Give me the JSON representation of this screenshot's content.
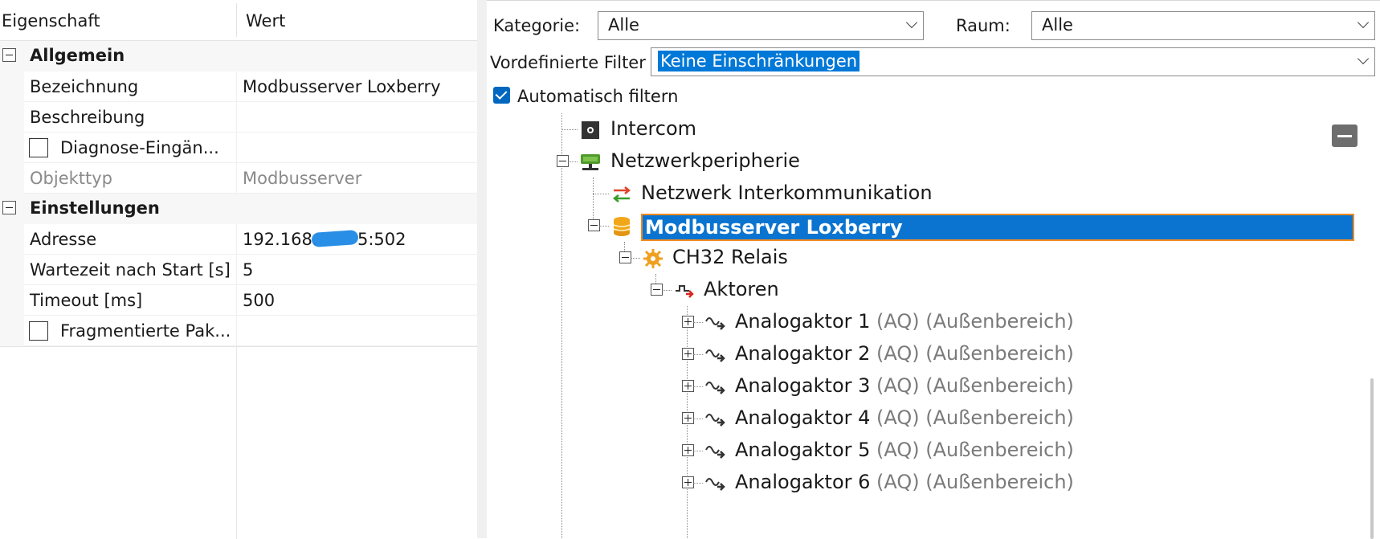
{
  "property_grid": {
    "headers": {
      "name": "Eigenschaft",
      "value": "Wert"
    },
    "categories": {
      "general": "Allgemein",
      "settings": "Einstellungen"
    },
    "rows": {
      "bezeichnung": {
        "name": "Bezeichnung",
        "value": "Modbusserver Loxberry"
      },
      "beschreibung": {
        "name": "Beschreibung",
        "value": ""
      },
      "diagnose": {
        "name": "Diagnose-Eingän..."
      },
      "objekttyp": {
        "name": "Objekttyp",
        "value": "Modbusserver"
      },
      "adresse": {
        "name": "Adresse",
        "value_prefix": "192.168.",
        "value_suffix": "5:502"
      },
      "wartezeit": {
        "name": "Wartezeit nach Start [s]",
        "value": "5"
      },
      "timeout": {
        "name": "Timeout [ms]",
        "value": "500"
      },
      "fragmentiert": {
        "name": "Fragmentierte Pak..."
      }
    }
  },
  "filter": {
    "kategorie_label": "Kategorie:",
    "kategorie_value": "Alle",
    "raum_label": "Raum:",
    "raum_value": "Alle",
    "vordefiniert_label": "Vordefinierte Filter",
    "vordefiniert_value": "Keine Einschränkungen",
    "auto_filter_label": "Automatisch filtern",
    "auto_filter_checked": true
  },
  "tree": {
    "intercom": "Intercom",
    "netzwerkperipherie": "Netzwerkperipherie",
    "interkommunikation": "Netzwerk Interkommunikation",
    "modbusserver": "Modbusserver Loxberry",
    "ch32": "CH32 Relais",
    "aktoren": "Aktoren",
    "analog_items": [
      {
        "name": "Analogaktor 1",
        "meta": "(AQ) (Außenbereich)"
      },
      {
        "name": "Analogaktor 2",
        "meta": "(AQ) (Außenbereich)"
      },
      {
        "name": "Analogaktor 3",
        "meta": "(AQ) (Außenbereich)"
      },
      {
        "name": "Analogaktor 4",
        "meta": "(AQ) (Außenbereich)"
      },
      {
        "name": "Analogaktor 5",
        "meta": "(AQ) (Außenbereich)"
      },
      {
        "name": "Analogaktor 6",
        "meta": "(AQ) (Außenbereich)"
      }
    ]
  },
  "colors": {
    "selection": "#0a74d0",
    "selection_border": "#f28a1e",
    "checkbox_accent": "#0067c0",
    "network_icon": "#4f9a2a"
  }
}
